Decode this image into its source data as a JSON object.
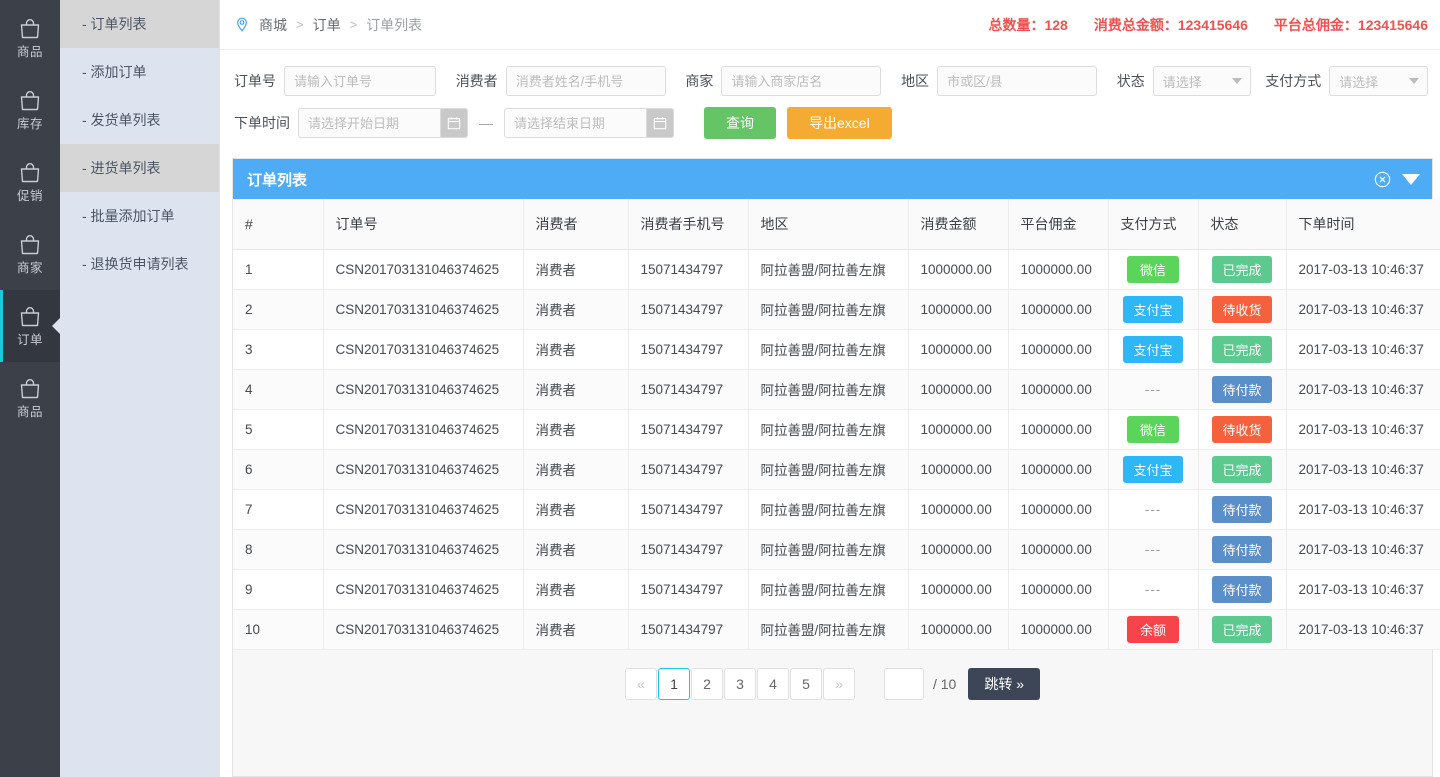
{
  "rail": {
    "items": [
      {
        "label": "商品",
        "icon": "bag-icon",
        "active": false
      },
      {
        "label": "库存",
        "icon": "bag-icon",
        "active": false
      },
      {
        "label": "促销",
        "icon": "bag-icon",
        "active": false
      },
      {
        "label": "商家",
        "icon": "bag-icon",
        "active": false
      },
      {
        "label": "订单",
        "icon": "bag-icon",
        "active": true
      },
      {
        "label": "商品",
        "icon": "bag-icon",
        "active": false
      }
    ]
  },
  "submenu": {
    "items": [
      {
        "label": "- 订单列表",
        "selected": true
      },
      {
        "label": "- 添加订单",
        "selected": false
      },
      {
        "label": "- 发货单列表",
        "selected": false
      },
      {
        "label": "- 进货单列表",
        "selected": true
      },
      {
        "label": "- 批量添加订单",
        "selected": false
      },
      {
        "label": "- 退换货申请列表",
        "selected": false
      }
    ]
  },
  "breadcrumb": {
    "icon": "location-pin-icon",
    "items": [
      "商城",
      "订单",
      "订单列表"
    ],
    "separator": ">"
  },
  "stats": {
    "color": "#ef5350",
    "total_count": "总数量：128",
    "total_amount": "消费总金额：123415646",
    "total_commission": "平台总佣金：123415646"
  },
  "filters": {
    "order_no_label": "订单号",
    "order_no_placeholder": "请输入订单号",
    "consumer_label": "消费者",
    "consumer_placeholder": "消费者姓名/手机号",
    "merchant_label": "商家",
    "merchant_placeholder": "请输入商家店名",
    "region_label": "地区",
    "region_placeholder": "市或区/县",
    "status_label": "状态",
    "status_value": "请选择",
    "payment_label": "支付方式",
    "payment_value": "请选择",
    "date_label": "下单时间",
    "date_start_placeholder": "请选择开始日期",
    "date_end_placeholder": "请选择结束日期",
    "date_separator": "—",
    "search_button": "查询",
    "export_button": "导出excel",
    "search_color": "#65c566",
    "export_color": "#f5ab32"
  },
  "panel": {
    "title": "订单列表",
    "header_color": "#4dacf5",
    "close_icon": "close-circle-icon",
    "collapse_icon": "chevron-down-icon"
  },
  "table": {
    "columns": [
      "#",
      "订单号",
      "消费者",
      "消费者手机号",
      "地区",
      "消费金额",
      "平台佣金",
      "支付方式",
      "状态",
      "下单时间"
    ],
    "rows": [
      {
        "idx": "1",
        "order_no": "CSN201703131046374625",
        "consumer": "消费者",
        "phone": "15071434797",
        "region": "阿拉善盟/阿拉善左旗",
        "amount": "1000000.00",
        "commission": "1000000.00",
        "payment": "微信",
        "payment_type": "wechat",
        "status": "已完成",
        "status_type": "done",
        "time": "2017-03-13 10:46:37"
      },
      {
        "idx": "2",
        "order_no": "CSN201703131046374625",
        "consumer": "消费者",
        "phone": "15071434797",
        "region": "阿拉善盟/阿拉善左旗",
        "amount": "1000000.00",
        "commission": "1000000.00",
        "payment": "支付宝",
        "payment_type": "alipay",
        "status": "待收货",
        "status_type": "recv",
        "time": "2017-03-13 10:46:37"
      },
      {
        "idx": "3",
        "order_no": "CSN201703131046374625",
        "consumer": "消费者",
        "phone": "15071434797",
        "region": "阿拉善盟/阿拉善左旗",
        "amount": "1000000.00",
        "commission": "1000000.00",
        "payment": "支付宝",
        "payment_type": "alipay",
        "status": "已完成",
        "status_type": "done",
        "time": "2017-03-13 10:46:37"
      },
      {
        "idx": "4",
        "order_no": "CSN201703131046374625",
        "consumer": "消费者",
        "phone": "15071434797",
        "region": "阿拉善盟/阿拉善左旗",
        "amount": "1000000.00",
        "commission": "1000000.00",
        "payment": "---",
        "payment_type": "none",
        "status": "待付款",
        "status_type": "pay",
        "time": "2017-03-13 10:46:37"
      },
      {
        "idx": "5",
        "order_no": "CSN201703131046374625",
        "consumer": "消费者",
        "phone": "15071434797",
        "region": "阿拉善盟/阿拉善左旗",
        "amount": "1000000.00",
        "commission": "1000000.00",
        "payment": "微信",
        "payment_type": "wechat",
        "status": "待收货",
        "status_type": "recv",
        "time": "2017-03-13 10:46:37"
      },
      {
        "idx": "6",
        "order_no": "CSN201703131046374625",
        "consumer": "消费者",
        "phone": "15071434797",
        "region": "阿拉善盟/阿拉善左旗",
        "amount": "1000000.00",
        "commission": "1000000.00",
        "payment": "支付宝",
        "payment_type": "alipay",
        "status": "已完成",
        "status_type": "done",
        "time": "2017-03-13 10:46:37"
      },
      {
        "idx": "7",
        "order_no": "CSN201703131046374625",
        "consumer": "消费者",
        "phone": "15071434797",
        "region": "阿拉善盟/阿拉善左旗",
        "amount": "1000000.00",
        "commission": "1000000.00",
        "payment": "---",
        "payment_type": "none",
        "status": "待付款",
        "status_type": "pay",
        "time": "2017-03-13 10:46:37"
      },
      {
        "idx": "8",
        "order_no": "CSN201703131046374625",
        "consumer": "消费者",
        "phone": "15071434797",
        "region": "阿拉善盟/阿拉善左旗",
        "amount": "1000000.00",
        "commission": "1000000.00",
        "payment": "---",
        "payment_type": "none",
        "status": "待付款",
        "status_type": "pay",
        "time": "2017-03-13 10:46:37"
      },
      {
        "idx": "9",
        "order_no": "CSN201703131046374625",
        "consumer": "消费者",
        "phone": "15071434797",
        "region": "阿拉善盟/阿拉善左旗",
        "amount": "1000000.00",
        "commission": "1000000.00",
        "payment": "---",
        "payment_type": "none",
        "status": "待付款",
        "status_type": "pay",
        "time": "2017-03-13 10:46:37"
      },
      {
        "idx": "10",
        "order_no": "CSN201703131046374625",
        "consumer": "消费者",
        "phone": "15071434797",
        "region": "阿拉善盟/阿拉善左旗",
        "amount": "1000000.00",
        "commission": "1000000.00",
        "payment": "余额",
        "payment_type": "balance",
        "status": "已完成",
        "status_type": "done",
        "time": "2017-03-13 10:46:37"
      }
    ]
  },
  "pagination": {
    "prev": "«",
    "next": "»",
    "pages": [
      "1",
      "2",
      "3",
      "4",
      "5"
    ],
    "active_page": "1",
    "jump_value": "",
    "total_label": "/ 10",
    "jump_button": "跳转 »"
  }
}
